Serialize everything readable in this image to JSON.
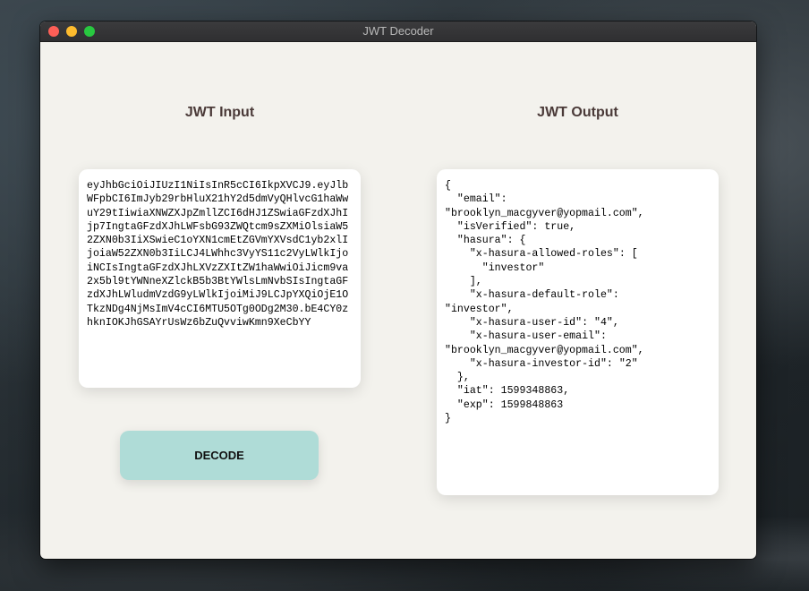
{
  "window": {
    "title": "JWT Decoder"
  },
  "input_section": {
    "heading": "JWT Input",
    "token": "eyJhbGciOiJIUzI1NiIsInR5cCI6IkpXVCJ9.eyJlbWFpbCI6ImJyb29rbHluX21hY2d5dmVyQHlvcG1haWwuY29tIiwiaXNWZXJpZmllZCI6dHJ1ZSwiaGFzdXJhIjp7IngtaGFzdXJhLWFsbG93ZWQtcm9sZXMiOlsiaW52ZXN0b3IiXSwieC1oYXN1cmEtZGVmYXVsdC1yb2xlIjoiaW52ZXN0b3IiLCJ4LWhhc3VyYS11c2VyLWlkIjoiNCIsIngtaGFzdXJhLXVzZXItZW1haWwiOiJicm9va2x5bl9tYWNneXZlckB5b3BtYWlsLmNvbSIsIngtaGFzdXJhLWludmVzdG9yLWlkIjoiMiJ9LCJpYXQiOjE1OTkzNDg4NjMsImV4cCI6MTU5OTg0ODg2M30.bE4CY0zhknIOKJhGSAYrUsWz6bZuQvviwKmn9XeCbYY"
  },
  "decode_button": {
    "label": "DECODE"
  },
  "output_section": {
    "heading": "JWT Output",
    "json": "{\n  \"email\":\n\"brooklyn_macgyver@yopmail.com\",\n  \"isVerified\": true,\n  \"hasura\": {\n    \"x-hasura-allowed-roles\": [\n      \"investor\"\n    ],\n    \"x-hasura-default-role\":\n\"investor\",\n    \"x-hasura-user-id\": \"4\",\n    \"x-hasura-user-email\":\n\"brooklyn_macgyver@yopmail.com\",\n    \"x-hasura-investor-id\": \"2\"\n  },\n  \"iat\": 1599348863,\n  \"exp\": 1599848863\n}"
  },
  "colors": {
    "window_background": "#f3f2ed",
    "heading_color": "#4a3a38",
    "decode_button_background": "#afdcd7"
  }
}
